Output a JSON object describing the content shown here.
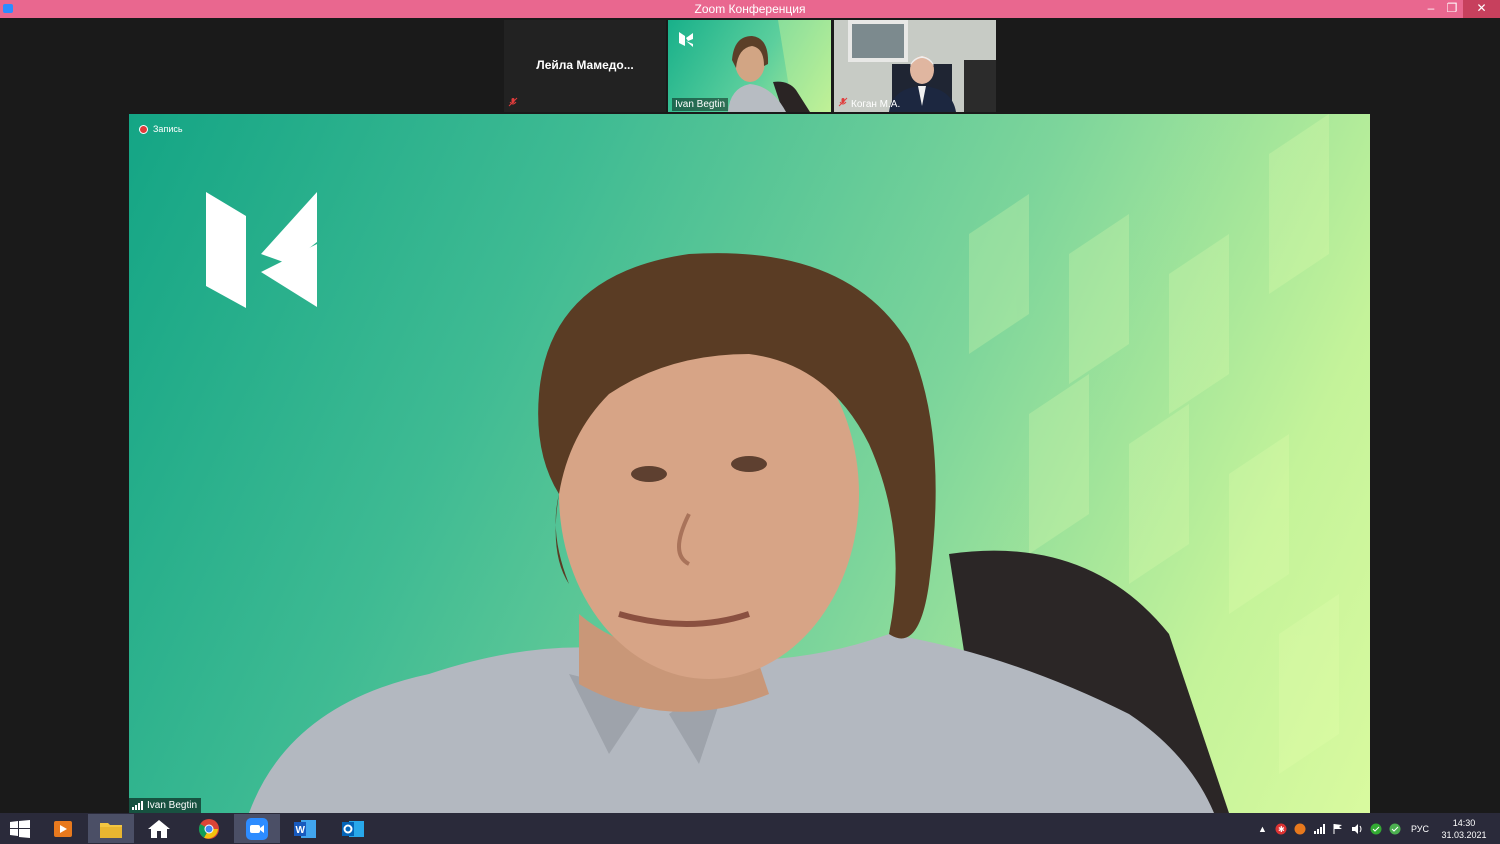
{
  "window": {
    "title": "Zoom Конференция",
    "controls": {
      "minimize": "–",
      "restore": "❐",
      "close": "✕"
    }
  },
  "thumbnails": [
    {
      "name": "Лейла  Мамедо...",
      "muted": true,
      "video": false
    },
    {
      "name": "Ivan Begtin",
      "muted": false,
      "video": true
    },
    {
      "name": "Коган М.А.",
      "muted": true,
      "video": true
    }
  ],
  "main": {
    "recording_label": "Запись",
    "speaker_name": "Ivan Begtin"
  },
  "taskbar": {
    "apps": [
      "start",
      "media-player",
      "file-explorer",
      "home",
      "chrome",
      "zoom",
      "word",
      "outlook"
    ],
    "active_app": "zoom",
    "language": "РУС",
    "time": "14:30",
    "date": "31.03.2021"
  },
  "colors": {
    "titlebar": "#e9678f",
    "background": "#1a1a1a",
    "taskbar": "#2a2a3a",
    "green_backdrop": "#3fbb93"
  }
}
